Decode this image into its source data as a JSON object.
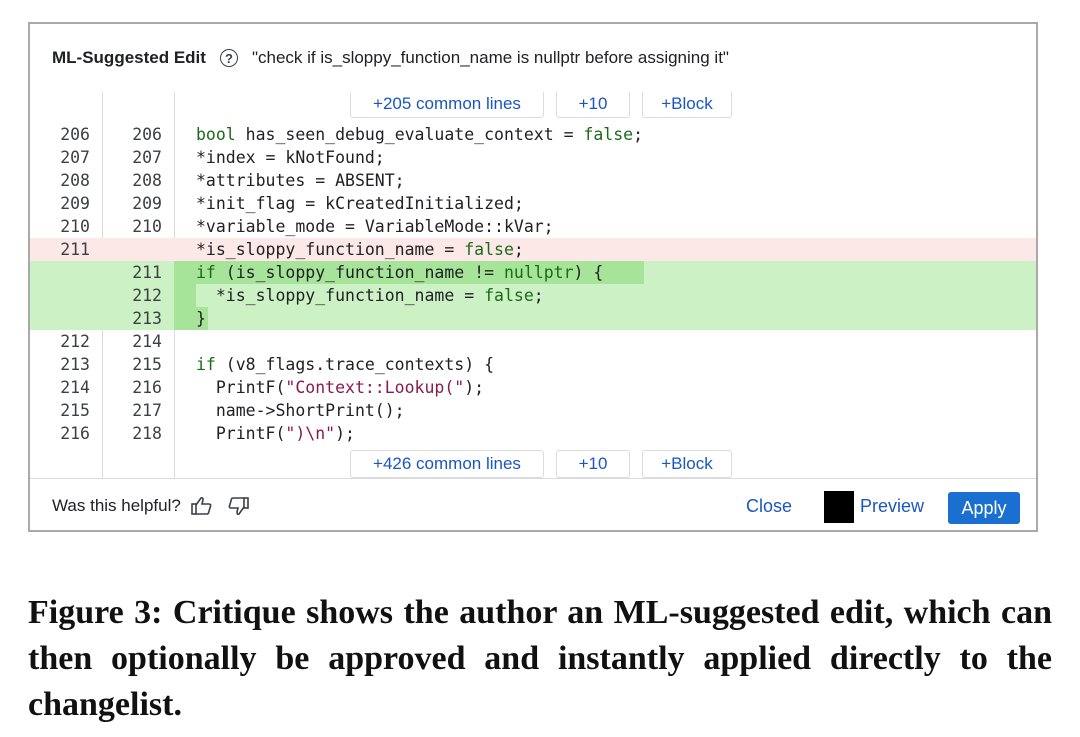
{
  "header": {
    "title": "ML-Suggested Edit",
    "help_icon": "question-circle-icon",
    "description": "\"check if is_sloppy_function_name is nullptr before assigning it\""
  },
  "expand_top": {
    "common": "+205 common lines",
    "plus10": "+10",
    "block": "+Block"
  },
  "expand_bottom": {
    "common": "+426 common lines",
    "plus10": "+10",
    "block": "+Block"
  },
  "lines": [
    {
      "old": "206",
      "new": "206",
      "type": "context"
    },
    {
      "old": "207",
      "new": "207",
      "type": "context"
    },
    {
      "old": "208",
      "new": "208",
      "type": "context"
    },
    {
      "old": "209",
      "new": "209",
      "type": "context"
    },
    {
      "old": "210",
      "new": "210",
      "type": "context"
    },
    {
      "old": "211",
      "new": "",
      "type": "removed"
    },
    {
      "old": "",
      "new": "211",
      "type": "added"
    },
    {
      "old": "",
      "new": "212",
      "type": "added"
    },
    {
      "old": "",
      "new": "213",
      "type": "added"
    },
    {
      "old": "212",
      "new": "214",
      "type": "context"
    },
    {
      "old": "213",
      "new": "215",
      "type": "context"
    },
    {
      "old": "214",
      "new": "216",
      "type": "context"
    },
    {
      "old": "215",
      "new": "217",
      "type": "context"
    },
    {
      "old": "216",
      "new": "218",
      "type": "context"
    }
  ],
  "code": {
    "l0a": "bool",
    "l0b": " has_seen_debug_evaluate_context = ",
    "l0c": "false",
    "l0d": ";",
    "l1": "*index = kNotFound;",
    "l2": "*attributes = ABSENT;",
    "l3": "*init_flag = kCreatedInitialized;",
    "l4": "*variable_mode = VariableMode::kVar;",
    "l5a": "*is_sloppy_function_name = ",
    "l5b": "false",
    "l5c": ";",
    "l6a": "if",
    "l6b": " (is_sloppy_function_name != ",
    "l6c": "nullptr",
    "l6d": ") {",
    "l7a": "  *is_sloppy_function_name = ",
    "l7b": "false",
    "l7c": ";",
    "l8": "}",
    "l9": "",
    "l10a": "if",
    "l10b": " (v8_flags.trace_contexts) {",
    "l11a": "  PrintF(",
    "l11b": "\"Context::Lookup(\"",
    "l11c": ");",
    "l12": "  name->ShortPrint();",
    "l13a": "  PrintF(",
    "l13b": "\")\\n\"",
    "l13c": ");"
  },
  "footer": {
    "helpful": "Was this helpful?",
    "thumbs_up": "thumbs-up-icon",
    "thumbs_down": "thumbs-down-icon",
    "close": "Close",
    "preview": "Preview",
    "apply": "Apply"
  },
  "caption": "Figure 3: Critique shows the author an ML-suggested edit, which can then optionally be approved and instantly applied directly to the changelist."
}
